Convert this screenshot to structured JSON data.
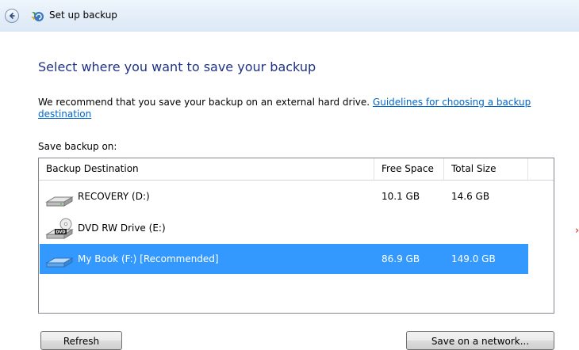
{
  "window": {
    "title": "Set up backup",
    "back_icon": "back-arrow-icon",
    "app_icon": "backup-icon"
  },
  "main": {
    "heading": "Select where you want to save your backup",
    "recommendation": "We recommend that you save your backup on an external hard drive.",
    "guidelines_link": "Guidelines for choosing a backup destination",
    "save_label": "Save backup on:"
  },
  "table": {
    "columns": [
      "Backup Destination",
      "Free Space",
      "Total Size"
    ],
    "rows": [
      {
        "name": "RECOVERY (D:)",
        "free": "10.1 GB",
        "total": "14.6 GB",
        "icon": "hard-drive-icon",
        "selected": false
      },
      {
        "name": "DVD RW Drive (E:)",
        "free": "",
        "total": "",
        "icon": "dvd-drive-icon",
        "selected": false
      },
      {
        "name": "My Book (F:) [Recommended]",
        "free": "86.9 GB",
        "total": "149.0 GB",
        "icon": "external-drive-icon",
        "selected": true
      }
    ]
  },
  "buttons": {
    "refresh": "Refresh",
    "network": "Save on a network..."
  },
  "colors": {
    "heading": "#1e3287",
    "link": "#0066cc",
    "selection": "#3399ff"
  }
}
